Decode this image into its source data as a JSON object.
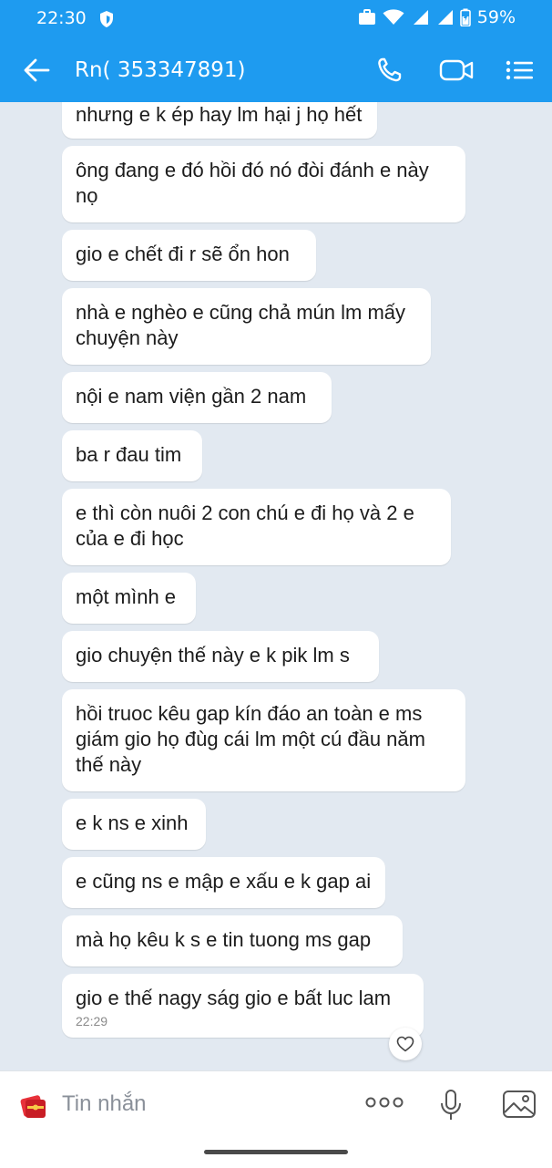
{
  "status_bar": {
    "time": "22:30",
    "battery": "59%"
  },
  "header": {
    "title": "Rn( 353347891)",
    "background": "#1e9bf0"
  },
  "messages": [
    {
      "text": "nhưng e k ép hay lm hại j họ hết"
    },
    {
      "text": "ông đang e đó hồi đó nó đòi đánh e này nọ"
    },
    {
      "text": "gio e chết đi r sẽ ổn hon"
    },
    {
      "text": "nhà e nghèo e cũng chả mún lm mấy chuyện này"
    },
    {
      "text": "nội e nam viện gần 2 nam"
    },
    {
      "text": "ba r đau tim"
    },
    {
      "text": "e thì còn nuôi 2 con chú e đi họ và 2 e của e đi học"
    },
    {
      "text": "một mình e"
    },
    {
      "text": "gio chuyện thế này e k pik lm s"
    },
    {
      "text": "hồi truoc kêu gap kín đáo an toàn e ms giám gio họ đùg cái lm một cú đầu năm thế này"
    },
    {
      "text": "e k ns e xinh"
    },
    {
      "text": "e cũng ns e mập e xấu e k gap ai"
    },
    {
      "text": "mà họ kêu k s e tin tuong ms gap"
    },
    {
      "text": "gio e thế nagy ság gio e bất luc lam",
      "time": "22:29"
    }
  ],
  "input": {
    "placeholder": "Tin nhắn"
  },
  "icons": [
    "back-arrow",
    "phone",
    "video-camera",
    "list-menu",
    "heart",
    "sticker",
    "more",
    "microphone",
    "image"
  ]
}
